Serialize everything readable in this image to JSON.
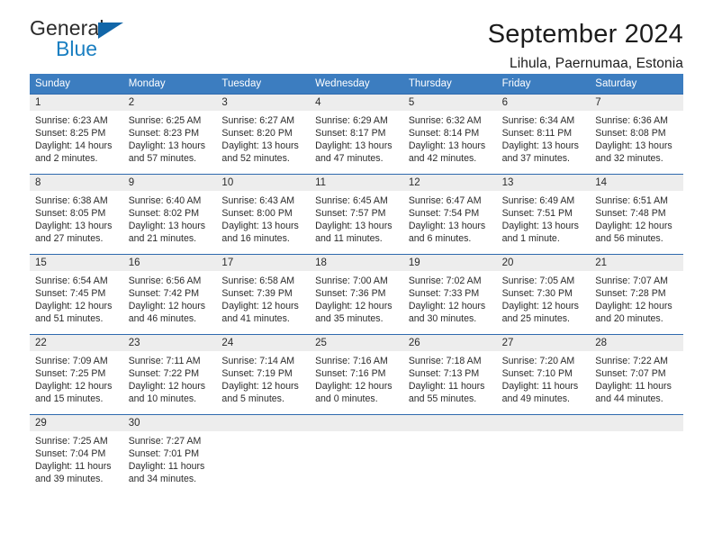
{
  "logo": {
    "word1": "General",
    "word2": "Blue",
    "triangle_color": "#1266a8",
    "blue_color": "#1a7fc1"
  },
  "header": {
    "title": "September 2024",
    "subtitle": "Lihula, Paernumaa, Estonia"
  },
  "theme": {
    "header_blue": "#3c7dc0",
    "row_border_blue": "#2f6aae",
    "daynum_band": "#ededed"
  },
  "weekdays": [
    "Sunday",
    "Monday",
    "Tuesday",
    "Wednesday",
    "Thursday",
    "Friday",
    "Saturday"
  ],
  "weeks": [
    [
      {
        "day": "1",
        "sunrise": "Sunrise: 6:23 AM",
        "sunset": "Sunset: 8:25 PM",
        "daylight1": "Daylight: 14 hours",
        "daylight2": "and 2 minutes."
      },
      {
        "day": "2",
        "sunrise": "Sunrise: 6:25 AM",
        "sunset": "Sunset: 8:23 PM",
        "daylight1": "Daylight: 13 hours",
        "daylight2": "and 57 minutes."
      },
      {
        "day": "3",
        "sunrise": "Sunrise: 6:27 AM",
        "sunset": "Sunset: 8:20 PM",
        "daylight1": "Daylight: 13 hours",
        "daylight2": "and 52 minutes."
      },
      {
        "day": "4",
        "sunrise": "Sunrise: 6:29 AM",
        "sunset": "Sunset: 8:17 PM",
        "daylight1": "Daylight: 13 hours",
        "daylight2": "and 47 minutes."
      },
      {
        "day": "5",
        "sunrise": "Sunrise: 6:32 AM",
        "sunset": "Sunset: 8:14 PM",
        "daylight1": "Daylight: 13 hours",
        "daylight2": "and 42 minutes."
      },
      {
        "day": "6",
        "sunrise": "Sunrise: 6:34 AM",
        "sunset": "Sunset: 8:11 PM",
        "daylight1": "Daylight: 13 hours",
        "daylight2": "and 37 minutes."
      },
      {
        "day": "7",
        "sunrise": "Sunrise: 6:36 AM",
        "sunset": "Sunset: 8:08 PM",
        "daylight1": "Daylight: 13 hours",
        "daylight2": "and 32 minutes."
      }
    ],
    [
      {
        "day": "8",
        "sunrise": "Sunrise: 6:38 AM",
        "sunset": "Sunset: 8:05 PM",
        "daylight1": "Daylight: 13 hours",
        "daylight2": "and 27 minutes."
      },
      {
        "day": "9",
        "sunrise": "Sunrise: 6:40 AM",
        "sunset": "Sunset: 8:02 PM",
        "daylight1": "Daylight: 13 hours",
        "daylight2": "and 21 minutes."
      },
      {
        "day": "10",
        "sunrise": "Sunrise: 6:43 AM",
        "sunset": "Sunset: 8:00 PM",
        "daylight1": "Daylight: 13 hours",
        "daylight2": "and 16 minutes."
      },
      {
        "day": "11",
        "sunrise": "Sunrise: 6:45 AM",
        "sunset": "Sunset: 7:57 PM",
        "daylight1": "Daylight: 13 hours",
        "daylight2": "and 11 minutes."
      },
      {
        "day": "12",
        "sunrise": "Sunrise: 6:47 AM",
        "sunset": "Sunset: 7:54 PM",
        "daylight1": "Daylight: 13 hours",
        "daylight2": "and 6 minutes."
      },
      {
        "day": "13",
        "sunrise": "Sunrise: 6:49 AM",
        "sunset": "Sunset: 7:51 PM",
        "daylight1": "Daylight: 13 hours",
        "daylight2": "and 1 minute."
      },
      {
        "day": "14",
        "sunrise": "Sunrise: 6:51 AM",
        "sunset": "Sunset: 7:48 PM",
        "daylight1": "Daylight: 12 hours",
        "daylight2": "and 56 minutes."
      }
    ],
    [
      {
        "day": "15",
        "sunrise": "Sunrise: 6:54 AM",
        "sunset": "Sunset: 7:45 PM",
        "daylight1": "Daylight: 12 hours",
        "daylight2": "and 51 minutes."
      },
      {
        "day": "16",
        "sunrise": "Sunrise: 6:56 AM",
        "sunset": "Sunset: 7:42 PM",
        "daylight1": "Daylight: 12 hours",
        "daylight2": "and 46 minutes."
      },
      {
        "day": "17",
        "sunrise": "Sunrise: 6:58 AM",
        "sunset": "Sunset: 7:39 PM",
        "daylight1": "Daylight: 12 hours",
        "daylight2": "and 41 minutes."
      },
      {
        "day": "18",
        "sunrise": "Sunrise: 7:00 AM",
        "sunset": "Sunset: 7:36 PM",
        "daylight1": "Daylight: 12 hours",
        "daylight2": "and 35 minutes."
      },
      {
        "day": "19",
        "sunrise": "Sunrise: 7:02 AM",
        "sunset": "Sunset: 7:33 PM",
        "daylight1": "Daylight: 12 hours",
        "daylight2": "and 30 minutes."
      },
      {
        "day": "20",
        "sunrise": "Sunrise: 7:05 AM",
        "sunset": "Sunset: 7:30 PM",
        "daylight1": "Daylight: 12 hours",
        "daylight2": "and 25 minutes."
      },
      {
        "day": "21",
        "sunrise": "Sunrise: 7:07 AM",
        "sunset": "Sunset: 7:28 PM",
        "daylight1": "Daylight: 12 hours",
        "daylight2": "and 20 minutes."
      }
    ],
    [
      {
        "day": "22",
        "sunrise": "Sunrise: 7:09 AM",
        "sunset": "Sunset: 7:25 PM",
        "daylight1": "Daylight: 12 hours",
        "daylight2": "and 15 minutes."
      },
      {
        "day": "23",
        "sunrise": "Sunrise: 7:11 AM",
        "sunset": "Sunset: 7:22 PM",
        "daylight1": "Daylight: 12 hours",
        "daylight2": "and 10 minutes."
      },
      {
        "day": "24",
        "sunrise": "Sunrise: 7:14 AM",
        "sunset": "Sunset: 7:19 PM",
        "daylight1": "Daylight: 12 hours",
        "daylight2": "and 5 minutes."
      },
      {
        "day": "25",
        "sunrise": "Sunrise: 7:16 AM",
        "sunset": "Sunset: 7:16 PM",
        "daylight1": "Daylight: 12 hours",
        "daylight2": "and 0 minutes."
      },
      {
        "day": "26",
        "sunrise": "Sunrise: 7:18 AM",
        "sunset": "Sunset: 7:13 PM",
        "daylight1": "Daylight: 11 hours",
        "daylight2": "and 55 minutes."
      },
      {
        "day": "27",
        "sunrise": "Sunrise: 7:20 AM",
        "sunset": "Sunset: 7:10 PM",
        "daylight1": "Daylight: 11 hours",
        "daylight2": "and 49 minutes."
      },
      {
        "day": "28",
        "sunrise": "Sunrise: 7:22 AM",
        "sunset": "Sunset: 7:07 PM",
        "daylight1": "Daylight: 11 hours",
        "daylight2": "and 44 minutes."
      }
    ],
    [
      {
        "day": "29",
        "sunrise": "Sunrise: 7:25 AM",
        "sunset": "Sunset: 7:04 PM",
        "daylight1": "Daylight: 11 hours",
        "daylight2": "and 39 minutes."
      },
      {
        "day": "30",
        "sunrise": "Sunrise: 7:27 AM",
        "sunset": "Sunset: 7:01 PM",
        "daylight1": "Daylight: 11 hours",
        "daylight2": "and 34 minutes."
      },
      {
        "day": "",
        "sunrise": "",
        "sunset": "",
        "daylight1": "",
        "daylight2": ""
      },
      {
        "day": "",
        "sunrise": "",
        "sunset": "",
        "daylight1": "",
        "daylight2": ""
      },
      {
        "day": "",
        "sunrise": "",
        "sunset": "",
        "daylight1": "",
        "daylight2": ""
      },
      {
        "day": "",
        "sunrise": "",
        "sunset": "",
        "daylight1": "",
        "daylight2": ""
      },
      {
        "day": "",
        "sunrise": "",
        "sunset": "",
        "daylight1": "",
        "daylight2": ""
      }
    ]
  ]
}
